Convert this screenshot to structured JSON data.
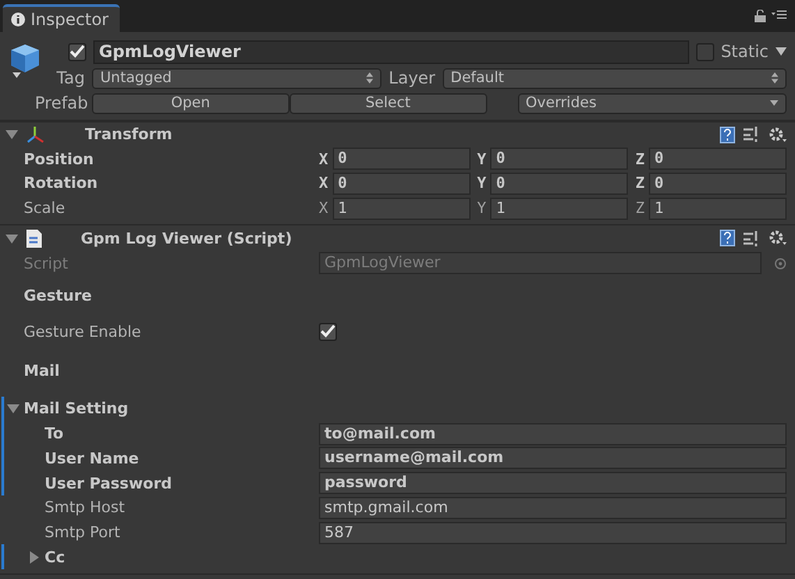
{
  "tab": {
    "label": "Inspector"
  },
  "object": {
    "active": true,
    "name": "GpmLogViewer",
    "static": false,
    "static_label": "Static",
    "tag_label": "Tag",
    "tag": "Untagged",
    "layer_label": "Layer",
    "layer": "Default",
    "prefab_label": "Prefab",
    "prefab_buttons": [
      "Open",
      "Select"
    ],
    "overrides": "Overrides"
  },
  "components": [
    {
      "kind": "transform",
      "title": "Transform",
      "expanded": true,
      "rows": [
        {
          "label": "Position",
          "modified": true,
          "values": [
            {
              "axis": "X",
              "value": "0"
            },
            {
              "axis": "Y",
              "value": "0"
            },
            {
              "axis": "Z",
              "value": "0"
            }
          ]
        },
        {
          "label": "Rotation",
          "modified": true,
          "values": [
            {
              "axis": "X",
              "value": "0"
            },
            {
              "axis": "Y",
              "value": "0"
            },
            {
              "axis": "Z",
              "value": "0"
            }
          ]
        },
        {
          "label": "Scale",
          "modified": false,
          "values": [
            {
              "axis": "X",
              "value": "1"
            },
            {
              "axis": "Y",
              "value": "1"
            },
            {
              "axis": "Z",
              "value": "1"
            }
          ]
        }
      ]
    },
    {
      "kind": "script",
      "title": "Gpm Log Viewer (Script)",
      "expanded": true,
      "script_label": "Script",
      "script": "GpmLogViewer",
      "rows": [
        {
          "kind": "header",
          "label": "Gesture"
        },
        {
          "kind": "checkbox",
          "label": "Gesture Enable",
          "checked": true,
          "modified": false
        },
        {
          "kind": "header",
          "label": "Mail"
        },
        {
          "kind": "foldout",
          "label": "Mail Setting",
          "expanded": true,
          "modified": true,
          "children": [
            {
              "kind": "text",
              "label": "To",
              "value": "to@mail.com",
              "modified": true
            },
            {
              "kind": "text",
              "label": "User Name",
              "value": "username@mail.com",
              "modified": true
            },
            {
              "kind": "text",
              "label": "User Password",
              "value": "password",
              "modified": true
            },
            {
              "kind": "text",
              "label": "Smtp Host",
              "value": "smtp.gmail.com",
              "modified": false
            },
            {
              "kind": "text",
              "label": "Smtp Port",
              "value": "587",
              "modified": false
            },
            {
              "kind": "foldout",
              "label": "Cc",
              "expanded": false,
              "modified": true
            }
          ]
        }
      ]
    }
  ]
}
